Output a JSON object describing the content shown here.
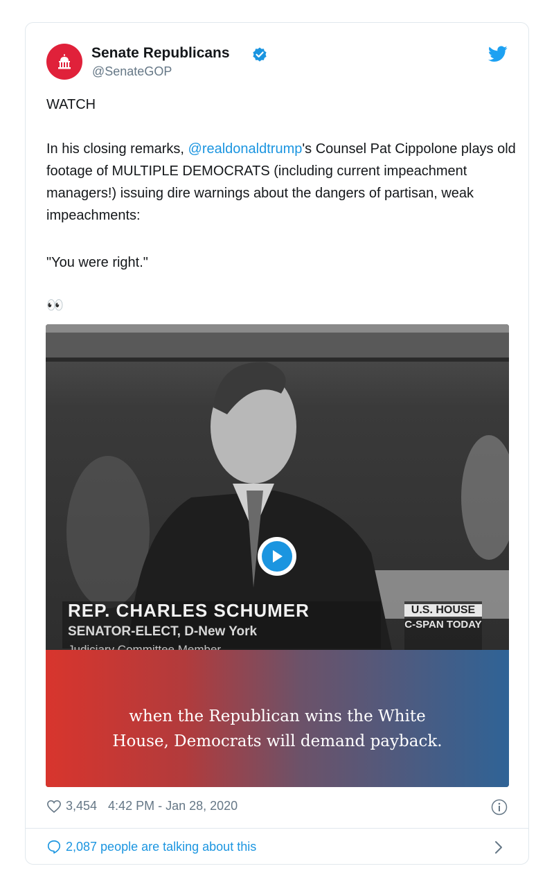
{
  "account": {
    "name": "Senate Republicans",
    "handle": "@SenateGOP",
    "verified": true
  },
  "tweet": {
    "line1": "WATCH",
    "para_before_mention": "In his closing remarks, ",
    "mention": "@realdonaldtrump",
    "para_after_mention": "'s Counsel Pat Cippolone plays old footage of MULTIPLE DEMOCRATS (including current impeachment managers!) issuing dire warnings about the dangers of partisan, weak impeachments:",
    "quote": "\"You were right.\"",
    "emoji": "👀"
  },
  "media": {
    "lower_third_name": "REP. CHARLES SCHUMER",
    "lower_third_sub1": "SENATOR-ELECT, D-New York",
    "lower_third_sub2": "Judiciary Committee Member",
    "house_label": "U.S. HOUSE",
    "network_label": "C-SPAN TODAY",
    "caption_line1": "when the Republican wins the White",
    "caption_line2": "House, Democrats will demand payback."
  },
  "footer": {
    "likes": "3,454",
    "timestamp": "4:42 PM - Jan 28, 2020",
    "talking": "2,087 people are talking about this"
  },
  "colors": {
    "brand_red": "#e0213a",
    "link_blue": "#1b95e0",
    "muted": "#657786"
  },
  "icons": [
    "capitol-icon",
    "verified-badge-icon",
    "twitter-bird-icon",
    "play-icon",
    "heart-icon",
    "info-icon",
    "speech-bubble-icon",
    "chevron-right-icon"
  ]
}
